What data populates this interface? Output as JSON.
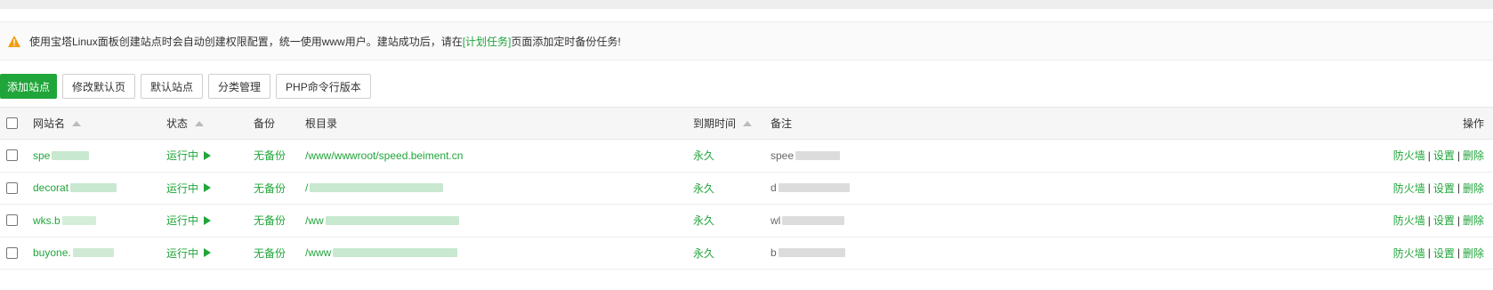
{
  "notice": {
    "text_before": "使用宝塔Linux面板创建站点时会自动创建权限配置，统一使用www用户。建站成功后，请在",
    "link": "[计划任务]",
    "text_after": "页面添加定时备份任务!"
  },
  "toolbar": {
    "add_site": "添加站点",
    "edit_default_page": "修改默认页",
    "default_site": "默认站点",
    "category_manage": "分类管理",
    "php_cli_version": "PHP命令行版本"
  },
  "table": {
    "headers": {
      "name": "网站名",
      "status": "状态",
      "backup": "备份",
      "root": "根目录",
      "expire": "到期时间",
      "remark": "备注",
      "ops": "操作"
    },
    "rows": [
      {
        "name": "spe",
        "status": "运行中",
        "backup": "无备份",
        "root": "/www/wwwroot/speed.beiment.cn",
        "expire": "永久",
        "remark": "spee"
      },
      {
        "name": "decorat",
        "status": "运行中",
        "backup": "无备份",
        "root": "/",
        "expire": "永久",
        "remark": "d"
      },
      {
        "name": "wks.b",
        "status": "运行中",
        "backup": "无备份",
        "root": "/ww",
        "expire": "永久",
        "remark": "wl"
      },
      {
        "name": "buyone.",
        "status": "运行中",
        "backup": "无备份",
        "root": "/www",
        "expire": "永久",
        "remark": "b"
      }
    ],
    "ops": {
      "firewall": "防火墙",
      "settings": "设置",
      "delete": "删除",
      "separator": "|"
    }
  },
  "colors": {
    "brand_green": "#20a53a",
    "warning_orange": "#f39c12"
  },
  "icons": {
    "notice": "warning-icon",
    "status": "play-icon",
    "sort": "sort-arrow-icon"
  }
}
